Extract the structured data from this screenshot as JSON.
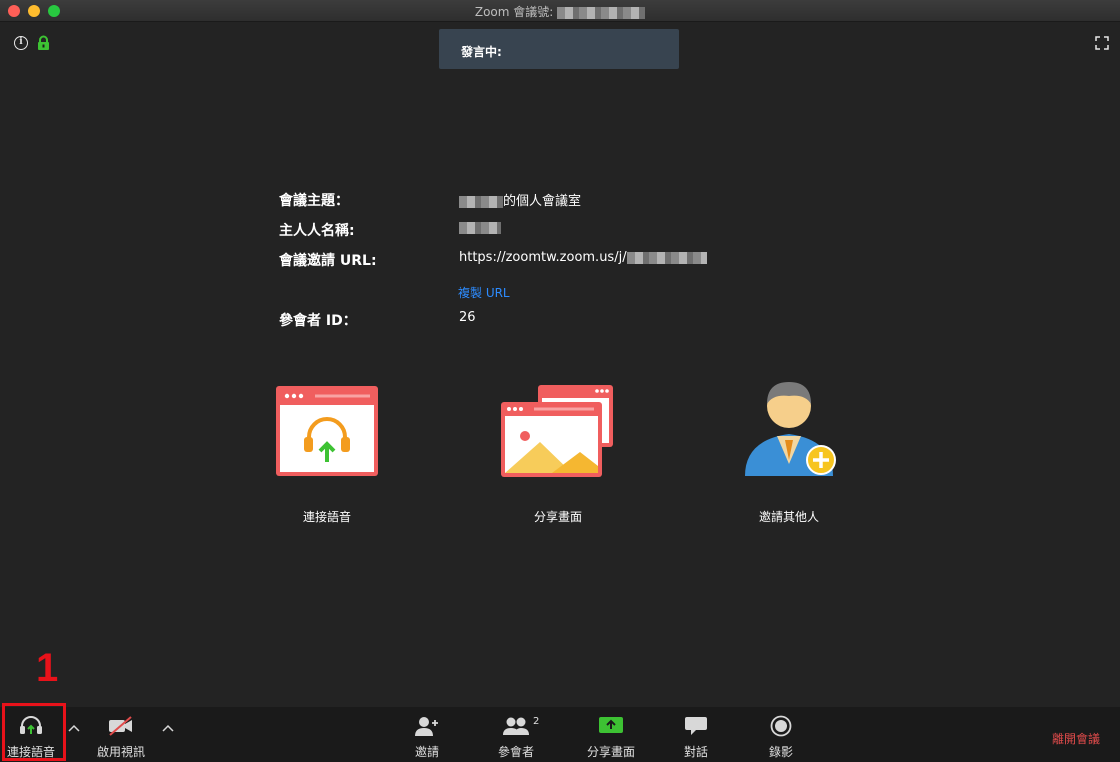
{
  "window": {
    "title": "Zoom 會議號:"
  },
  "overlay": {
    "speaking_label": "發言中:"
  },
  "meeting_info": {
    "topic_label": "會議主題：",
    "topic_value": "的個人會議室",
    "host_label": "主人人名稱:",
    "url_label": "會議邀請 URL:",
    "url_value": "https://zoomtw.zoom.us/j/",
    "copy_url": "複製 URL",
    "participant_id_label": "參會者 ID：",
    "participant_id_value": "26"
  },
  "actions": [
    {
      "label": "連接語音",
      "icon": "headset-upload-icon"
    },
    {
      "label": "分享畫面",
      "icon": "share-screen-icon"
    },
    {
      "label": "邀請其他人",
      "icon": "invite-person-icon"
    }
  ],
  "toolbar": {
    "audio": "連接語音",
    "video": "啟用視訊",
    "invite": "邀請",
    "participants": "參會者",
    "participants_count": "2",
    "share": "分享畫面",
    "chat": "對話",
    "record": "錄影",
    "leave": "離開會議"
  },
  "annotation": {
    "step": "1"
  },
  "colors": {
    "background": "#232323",
    "toolbar": "#1a1a1a",
    "accent_blue": "#2d8cff",
    "share_green": "#3dc233",
    "tile_red": "#f05e5e",
    "leave_red": "#e04b4b",
    "annotation_red": "#e8121a"
  }
}
